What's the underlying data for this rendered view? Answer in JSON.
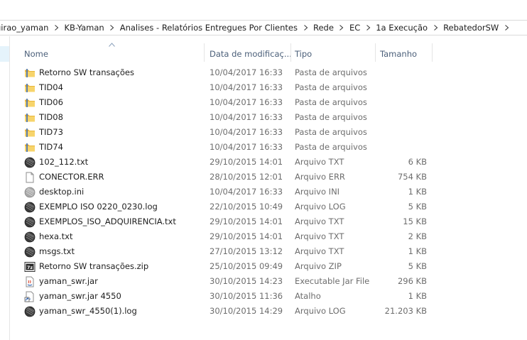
{
  "breadcrumb": [
    {
      "label": "girao_yaman"
    },
    {
      "label": "KB-Yaman"
    },
    {
      "label": "Analises - Relatórios Entregues Por Clientes"
    },
    {
      "label": "Rede"
    },
    {
      "label": "EC"
    },
    {
      "label": "1a Execução"
    },
    {
      "label": "RebatedorSW"
    }
  ],
  "columns": {
    "name": "Nome",
    "date": "Data de modificaç...",
    "type": "Tipo",
    "size": "Tamanho"
  },
  "files": [
    {
      "name": "Retorno SW transações",
      "date": "10/04/2017 16:33",
      "type": "Pasta de arquivos",
      "size": "",
      "icon": "folder-icon"
    },
    {
      "name": "TID04",
      "date": "10/04/2017 16:33",
      "type": "Pasta de arquivos",
      "size": "",
      "icon": "folder-icon"
    },
    {
      "name": "TID06",
      "date": "10/04/2017 16:33",
      "type": "Pasta de arquivos",
      "size": "",
      "icon": "folder-icon"
    },
    {
      "name": "TID08",
      "date": "10/04/2017 16:33",
      "type": "Pasta de arquivos",
      "size": "",
      "icon": "folder-icon"
    },
    {
      "name": "TID73",
      "date": "10/04/2017 16:33",
      "type": "Pasta de arquivos",
      "size": "",
      "icon": "folder-icon"
    },
    {
      "name": "TID74",
      "date": "10/04/2017 16:33",
      "type": "Pasta de arquivos",
      "size": "",
      "icon": "folder-icon"
    },
    {
      "name": "102_112.txt",
      "date": "29/10/2015 14:01",
      "type": "Arquivo TXT",
      "size": "6 KB",
      "icon": "dark-disc-icon"
    },
    {
      "name": "CONECTOR.ERR",
      "date": "28/10/2015 12:01",
      "type": "Arquivo ERR",
      "size": "754 KB",
      "icon": "blank-file-icon"
    },
    {
      "name": "desktop.ini",
      "date": "10/04/2017 16:33",
      "type": "Arquivo INI",
      "size": "1 KB",
      "icon": "grey-disc-icon"
    },
    {
      "name": "EXEMPLO ISO 0220_0230.log",
      "date": "22/10/2015 10:49",
      "type": "Arquivo LOG",
      "size": "5 KB",
      "icon": "dark-disc-icon"
    },
    {
      "name": "EXEMPLOS_ISO_ADQUIRENCIA.txt",
      "date": "29/10/2015 14:01",
      "type": "Arquivo TXT",
      "size": "15 KB",
      "icon": "dark-disc-icon"
    },
    {
      "name": "hexa.txt",
      "date": "29/10/2015 14:01",
      "type": "Arquivo TXT",
      "size": "2 KB",
      "icon": "dark-disc-icon"
    },
    {
      "name": "msgs.txt",
      "date": "27/10/2015 13:12",
      "type": "Arquivo TXT",
      "size": "1 KB",
      "icon": "dark-disc-icon"
    },
    {
      "name": "Retorno SW transações.zip",
      "date": "25/10/2015 09:49",
      "type": "Arquivo ZIP",
      "size": "5 KB",
      "icon": "zip-archive-icon"
    },
    {
      "name": "yaman_swr.jar",
      "date": "30/10/2015 14:23",
      "type": "Executable Jar File",
      "size": "296 KB",
      "icon": "jar-file-icon"
    },
    {
      "name": "yaman_swr.jar 4550",
      "date": "30/10/2015 11:36",
      "type": "Atalho",
      "size": "1 KB",
      "icon": "shortcut-icon"
    },
    {
      "name": "yaman_swr_4550(1).log",
      "date": "30/10/2015 14:29",
      "type": "Arquivo LOG",
      "size": "21.203 KB",
      "icon": "dark-disc-icon"
    }
  ]
}
